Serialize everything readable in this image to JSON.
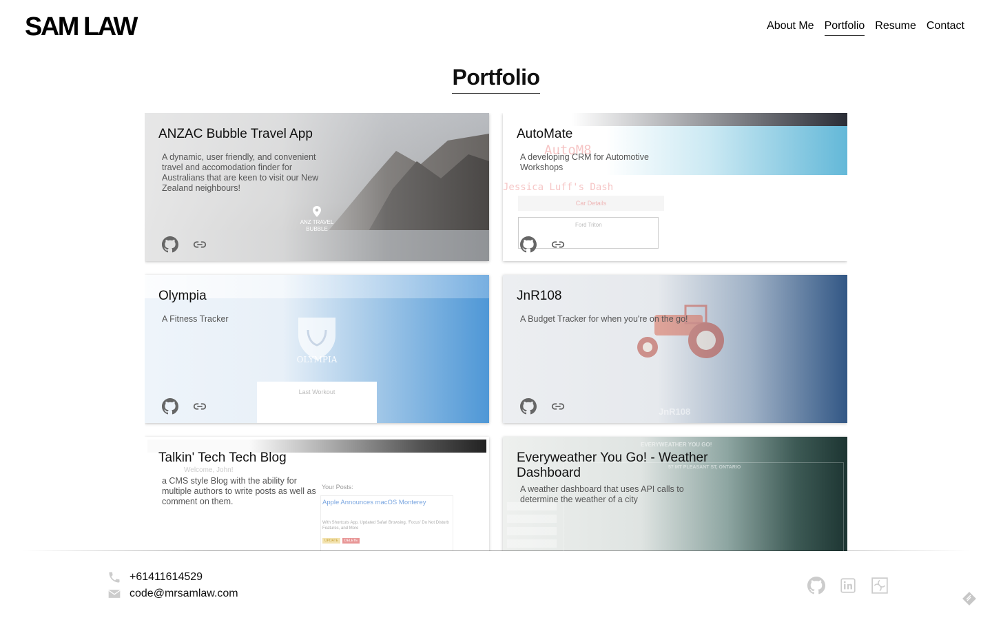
{
  "header": {
    "brand": "SAM LAW",
    "nav": [
      "About Me",
      "Portfolio",
      "Resume",
      "Contact"
    ],
    "active_nav": "Portfolio"
  },
  "page_title": "Portfolio",
  "projects": [
    {
      "title": "ANZAC Bubble Travel App",
      "description": "A dynamic, user friendly, and convenient travel and accomodation finder for Australians that are keen to visit our New Zealand neighbours!",
      "preview_text": [
        "ANZ TRAVEL",
        "BUBBLE"
      ]
    },
    {
      "title": "AutoMate",
      "description": "A developing CRM for Automotive Workshops",
      "preview_text": [
        "AutoM8",
        "Jessica Luff's Dash",
        "Car Details",
        "Ford Triton"
      ]
    },
    {
      "title": "Olympia",
      "description": "A Fitness Tracker",
      "preview_text": [
        "OLYMPIA",
        "Last Workout"
      ]
    },
    {
      "title": "JnR108",
      "description": "A Budget Tracker for when you're on the go!",
      "preview_text": [
        "JnR108"
      ]
    },
    {
      "title": "Talkin' Tech Tech Blog",
      "description": "a CMS style Blog with the ability for multiple authors to write posts as well as comment on them.",
      "preview_text": [
        "Welcome, John!",
        "Your Posts:",
        "Apple Announces macOS Monterey",
        "With Shortcuts App, Updated Safari Browsing, 'Focus' Do Not Disturb Features, and More",
        "UPDATE",
        "DELETE"
      ]
    },
    {
      "title": "Everyweather You Go! - Weather Dashboard",
      "description": "A weather dashboard that uses API calls to determine the weather of a city",
      "preview_text": [
        "EVERYWEATHER YOU GO!",
        "57 MT PLEASANT ST, ONTARIO"
      ]
    }
  ],
  "footer": {
    "phone": "+61411614529",
    "email": "code@mrsamlaw.com"
  },
  "icons": {
    "project_links": [
      "github-icon",
      "link-icon"
    ],
    "socials": [
      "github-icon",
      "linkedin-icon",
      "codesandbox-icon"
    ],
    "corner": "feather-icon"
  }
}
